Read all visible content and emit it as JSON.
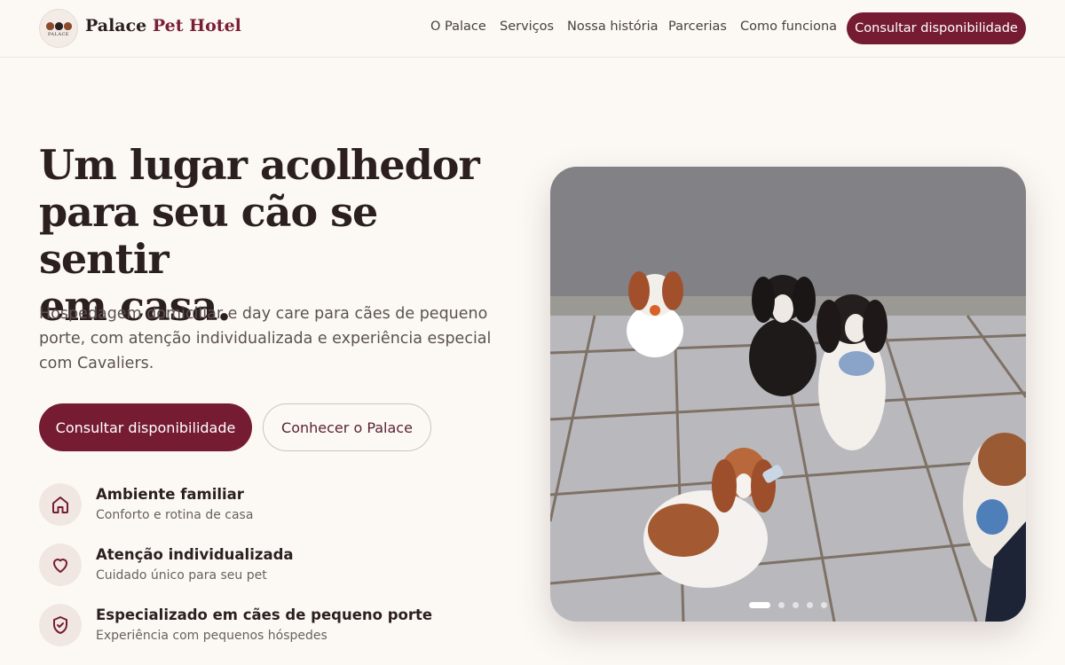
{
  "brand": {
    "name_part1": "Palace",
    "name_part2": "Pet Hotel",
    "logo_text": "PALACE",
    "accent_color": "#751c33"
  },
  "nav": {
    "items": [
      "O Palace",
      "Serviços",
      "Nossa história",
      "Parcerias",
      "Como funciona"
    ],
    "cta_label": "Consultar disponibilidade"
  },
  "hero": {
    "title_line1": "Um lugar acolhedor",
    "title_line2": "para seu cão se sentir",
    "title_line3": "em casa.",
    "subtitle": "Hospedagem domiciliar e day care para cães de pequeno porte, com atenção individualizada e experiência especial com Cavaliers.",
    "primary_button": "Consultar disponibilidade",
    "secondary_button": "Conhecer o Palace"
  },
  "features": [
    {
      "icon": "home-icon",
      "title": "Ambiente familiar",
      "desc": "Conforto e rotina de casa"
    },
    {
      "icon": "heart-icon",
      "title": "Atenção individualizada",
      "desc": "Cuidado único para seu pet"
    },
    {
      "icon": "shield-check-icon",
      "title": "Especializado em cães de pequeno porte",
      "desc": "Experiência com pequenos hóspedes"
    }
  ],
  "carousel": {
    "slide_count": 5,
    "active_index": 0
  }
}
